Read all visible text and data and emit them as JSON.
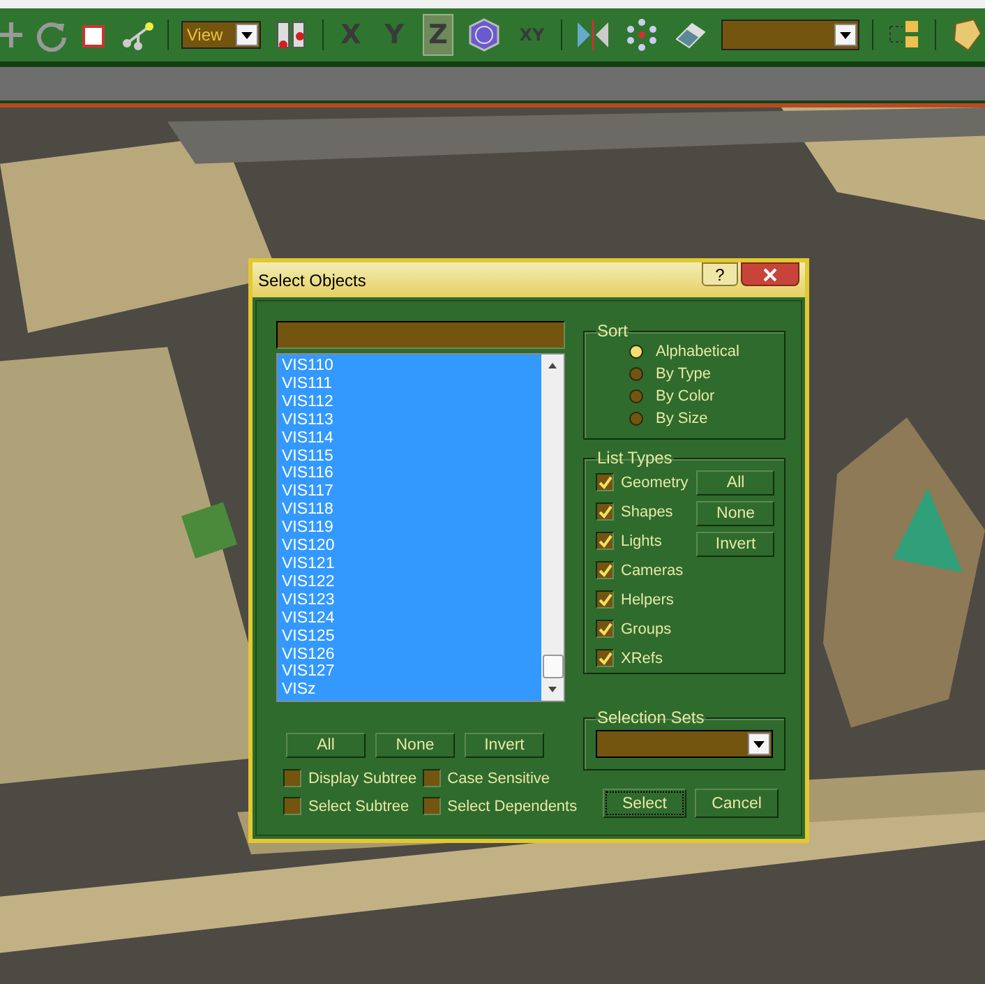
{
  "toolbar": {
    "view_dropdown": {
      "value": "View"
    },
    "axis_buttons": [
      {
        "label": "X",
        "selected": false
      },
      {
        "label": "Y",
        "selected": false
      },
      {
        "label": "Z",
        "selected": true
      }
    ],
    "plane_button": {
      "label": "XY",
      "selected": false
    }
  },
  "dialog": {
    "title": "Select Objects",
    "help_button": "?",
    "objects": [
      {
        "name": "VIS110",
        "selected": true
      },
      {
        "name": "VIS111",
        "selected": true
      },
      {
        "name": "VIS112",
        "selected": true
      },
      {
        "name": "VIS113",
        "selected": true
      },
      {
        "name": "VIS114",
        "selected": true
      },
      {
        "name": "VIS115",
        "selected": true
      },
      {
        "name": "VIS116",
        "selected": true
      },
      {
        "name": "VIS117",
        "selected": true
      },
      {
        "name": "VIS118",
        "selected": true
      },
      {
        "name": "VIS119",
        "selected": true
      },
      {
        "name": "VIS120",
        "selected": true
      },
      {
        "name": "VIS121",
        "selected": true
      },
      {
        "name": "VIS122",
        "selected": true
      },
      {
        "name": "VIS123",
        "selected": true
      },
      {
        "name": "VIS124",
        "selected": true
      },
      {
        "name": "VIS125",
        "selected": true
      },
      {
        "name": "VIS126",
        "selected": true
      },
      {
        "name": "VIS127",
        "selected": true
      },
      {
        "name": "VISz",
        "selected": true
      }
    ],
    "list_buttons": [
      "All",
      "None",
      "Invert"
    ],
    "options": [
      {
        "label": "Display Subtree",
        "checked": false
      },
      {
        "label": "Case Sensitive",
        "checked": false
      },
      {
        "label": "Select Subtree",
        "checked": false
      },
      {
        "label": "Select Dependents",
        "checked": false
      }
    ],
    "sort": {
      "title": "Sort",
      "options": [
        {
          "label": "Alphabetical",
          "selected": true
        },
        {
          "label": "By Type",
          "selected": false
        },
        {
          "label": "By Color",
          "selected": false
        },
        {
          "label": "By Size",
          "selected": false
        }
      ]
    },
    "list_types": {
      "title": "List Types",
      "types": [
        {
          "label": "Geometry",
          "checked": true
        },
        {
          "label": "Shapes",
          "checked": true
        },
        {
          "label": "Lights",
          "checked": true
        },
        {
          "label": "Cameras",
          "checked": true
        },
        {
          "label": "Helpers",
          "checked": true
        },
        {
          "label": "Groups",
          "checked": true
        },
        {
          "label": "XRefs",
          "checked": true
        }
      ],
      "buttons": [
        "All",
        "None",
        "Invert"
      ]
    },
    "selection_sets": {
      "title": "Selection Sets"
    },
    "actions": [
      {
        "label": "Select",
        "focused": true
      },
      {
        "label": "Cancel",
        "focused": false
      }
    ]
  }
}
